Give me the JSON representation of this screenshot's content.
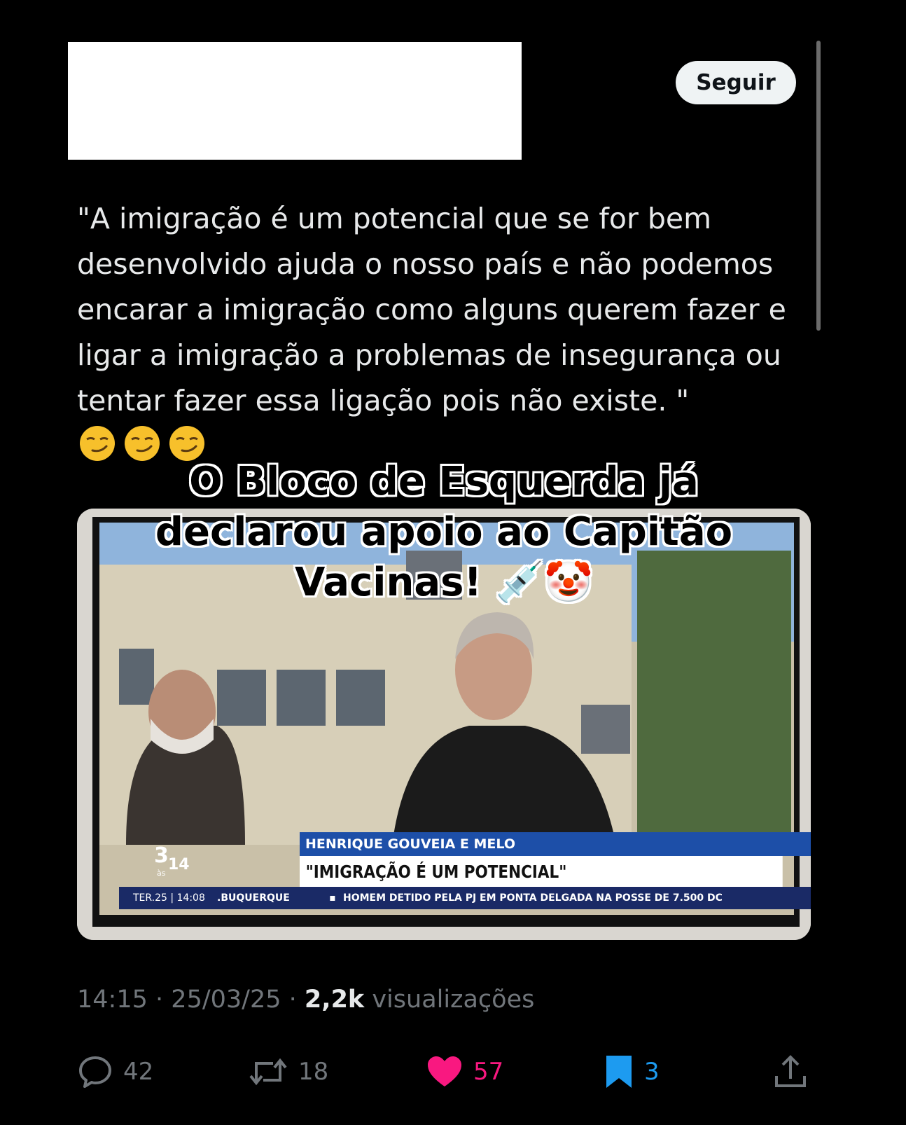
{
  "header": {
    "follow_label": "Seguir"
  },
  "tweet": {
    "text": "\"A imigração é um potencial que se for bem desenvolvido ajuda o nosso país e não podemos encarar a imigração como alguns querem fazer e ligar a imigração a problemas de insegurança ou tentar fazer essa ligação pois não existe. \"",
    "emojis": [
      "smirking-face",
      "smirking-face",
      "smirking-face"
    ]
  },
  "media": {
    "caption_lines": [
      "O Bloco de Esquerda já",
      "declarou apoio ao Capitão",
      "Vacinas! 💉🤡"
    ],
    "tv": {
      "name_strap": "HENRIQUE GOUVEIA E MELO",
      "quote": "\"IMIGRAÇÃO É UM POTENCIAL\"",
      "channel_big": "3",
      "channel_small": "14",
      "channel_sub": "às",
      "ticker_time": "TER.25 | 14:08",
      "ticker_location": ".BUQUERQUE",
      "ticker_dot": "▪",
      "ticker_headline": "HOMEM DETIDO PELA PJ EM PONTA DELGADA NA POSSE DE 7.500 DC"
    }
  },
  "meta": {
    "time": "14:15",
    "date": "25/03/25",
    "separator": "·",
    "views_count": "2,2k",
    "views_label": "visualizações"
  },
  "actions": {
    "replies": "42",
    "retweets": "18",
    "likes": "57",
    "bookmarks": "3"
  },
  "colors": {
    "background": "#000000",
    "text": "#e7e9ea",
    "muted": "#71767b",
    "like": "#f91880",
    "bookmark": "#1d9bf0"
  }
}
